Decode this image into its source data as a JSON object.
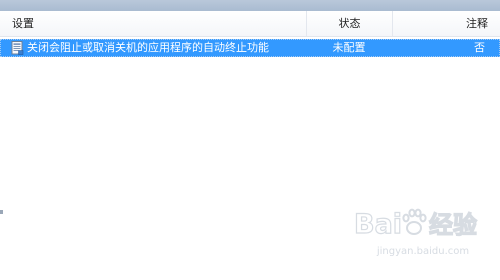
{
  "columns": {
    "setting": "设置",
    "state": "状态",
    "comment": "注释"
  },
  "rows": [
    {
      "icon": "policy-setting-icon",
      "setting": "关闭会阻止或取消关机的应用程序的自动终止功能",
      "state": "未配置",
      "comment": "否",
      "selected": true
    }
  ],
  "watermark": {
    "brand": "Baidu经验",
    "url": "jingyan.baidu.com"
  },
  "colors": {
    "selection": "#3399ff",
    "header_band": "#b9c8da"
  }
}
